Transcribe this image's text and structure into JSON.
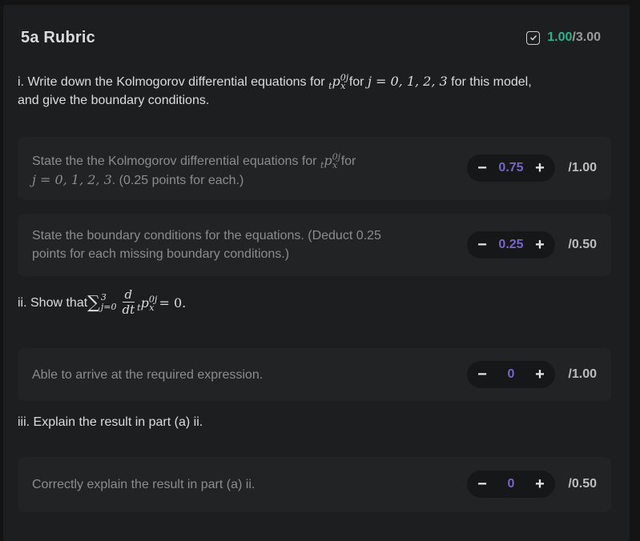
{
  "header": {
    "title": "5a Rubric",
    "score_earned": "1.00",
    "score_total": "/3.00"
  },
  "questions": [
    {
      "prefix": "i. Write down the Kolmogorov differential equations for ",
      "mid": " for ",
      "math_j": "j = 0, 1, 2, 3",
      "suffix": " for this model,",
      "line2": "and give the boundary conditions."
    },
    {
      "prefix": "ii. Show that ",
      "suffix": "= 0."
    },
    {
      "text": "iii. Explain the result in part (a) ii."
    }
  ],
  "criteria": [
    {
      "line1_prefix": "State the the Kolmogorov differential equations for ",
      "line1_suffix": " for",
      "line2_math": "j = 0, 1, 2, 3",
      "line2_text": ". (0.25 points for each.)",
      "value": "0.75",
      "max": "/1.00"
    },
    {
      "line1": "State the boundary conditions for the equations. (Deduct 0.25",
      "line2": "points for each missing boundary conditions.)",
      "value": "0.25",
      "max": "/0.50"
    },
    {
      "line1": "Able to arrive at the required expression.",
      "value": "0",
      "max": "/1.00"
    },
    {
      "line1": "Correctly explain the result in part (a) ii.",
      "value": "0",
      "max": "/0.50"
    }
  ],
  "math": {
    "p_symbol": "p",
    "sub_t": "t",
    "sup_0j": "0j",
    "sub_x": "x",
    "sum_upper": "3",
    "sum_lower": "j=0",
    "frac_num": "d",
    "frac_den": "dt"
  },
  "stepper": {
    "minus": "−",
    "plus": "+"
  },
  "colors": {
    "accent_green": "#27b48b",
    "accent_purple": "#7a64c8"
  },
  "icons": {
    "score": "checkbox-icon"
  }
}
